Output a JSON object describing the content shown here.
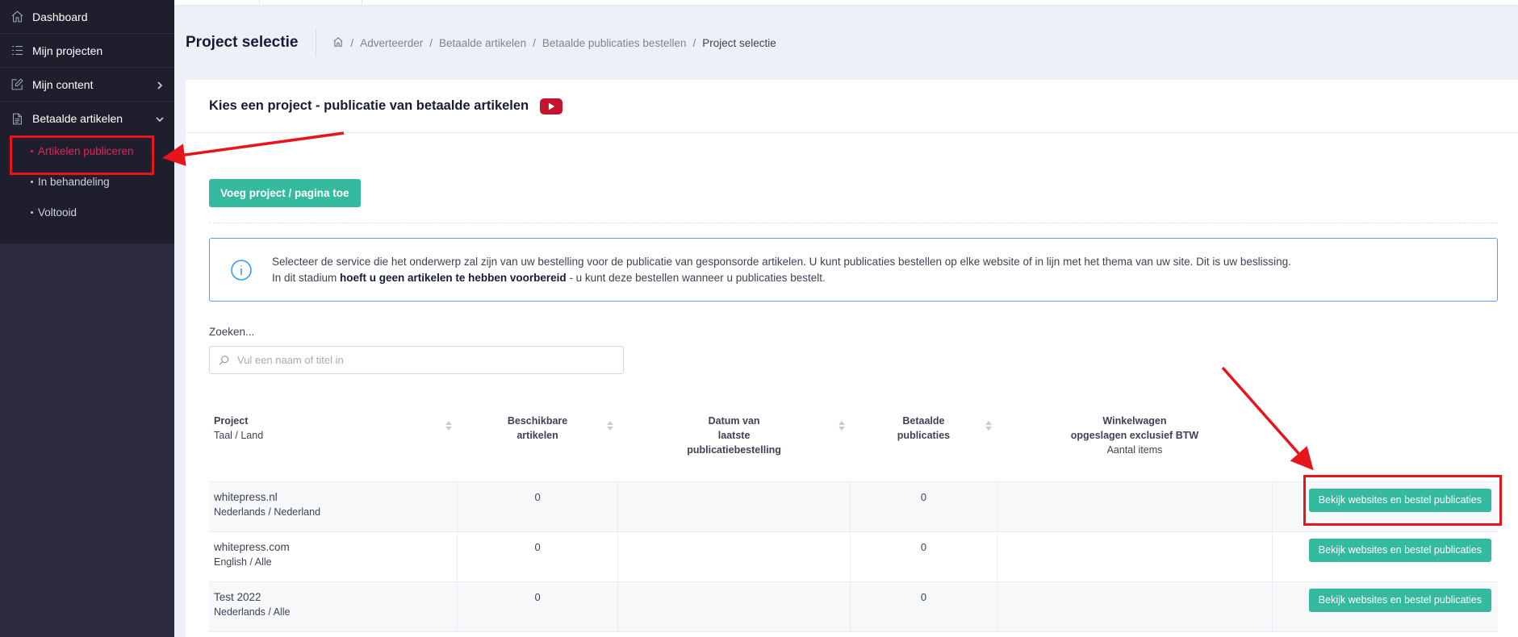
{
  "sidebar": {
    "items": [
      {
        "label": "Dashboard",
        "icon": "home-icon"
      },
      {
        "label": "Mijn projecten",
        "icon": "list-icon"
      },
      {
        "label": "Mijn content",
        "icon": "edit-icon"
      },
      {
        "label": "Betaalde artikelen",
        "icon": "document-icon"
      }
    ],
    "sub_items": [
      {
        "label": "Artikelen publiceren"
      },
      {
        "label": "In behandeling"
      },
      {
        "label": "Voltooid"
      }
    ]
  },
  "header": {
    "title": "Project selectie",
    "breadcrumbs": [
      "Adverteerder",
      "Betaalde artikelen",
      "Betaalde publicaties bestellen",
      "Project selectie"
    ]
  },
  "card": {
    "title": "Kies een project - publicatie van betaalde artikelen",
    "add_button": "Voeg project / pagina toe",
    "alert": {
      "line1": "Selecteer de service die het onderwerp zal zijn van uw bestelling voor de publicatie van gesponsorde artikelen. U kunt publicaties bestellen op elke website of in lijn met het thema van uw site. Dit is uw beslissing.",
      "line2_pre": "In dit stadium ",
      "line2_bold": "hoeft u geen artikelen te hebben voorbereid",
      "line2_post": " - u kunt deze bestellen wanneer u publicaties bestelt."
    },
    "search": {
      "label": "Zoeken...",
      "placeholder": "Vul een naam of titel in"
    }
  },
  "table": {
    "headers": {
      "project": "Project",
      "project_sub": "Taal / Land",
      "available_1": "Beschikbare",
      "available_2": "artikelen",
      "date_1": "Datum van",
      "date_2": "laatste",
      "date_3": "publicatiebestelling",
      "paid_1": "Betaalde",
      "paid_2": "publicaties",
      "cart_1": "Winkelwagen",
      "cart_2": "opgeslagen exclusief BTW",
      "cart_sub": "Aantal items"
    },
    "rows": [
      {
        "name": "whitepress.nl",
        "lang": "Nederlands / Nederland",
        "available": "0",
        "date": "",
        "paid": "0",
        "cart": "",
        "action": "Bekijk websites en bestel publicaties"
      },
      {
        "name": "whitepress.com",
        "lang": "English / Alle",
        "available": "0",
        "date": "",
        "paid": "0",
        "cart": "",
        "action": "Bekijk websites en bestel publicaties"
      },
      {
        "name": "Test 2022",
        "lang": "Nederlands / Alle",
        "available": "0",
        "date": "",
        "paid": "0",
        "cart": "",
        "action": "Bekijk websites en bestel publicaties"
      }
    ]
  },
  "colors": {
    "accent": "#35b99f",
    "sidebar_bg": "#1e1e2d",
    "active": "#e0245e",
    "annotation": "#e8141b"
  }
}
